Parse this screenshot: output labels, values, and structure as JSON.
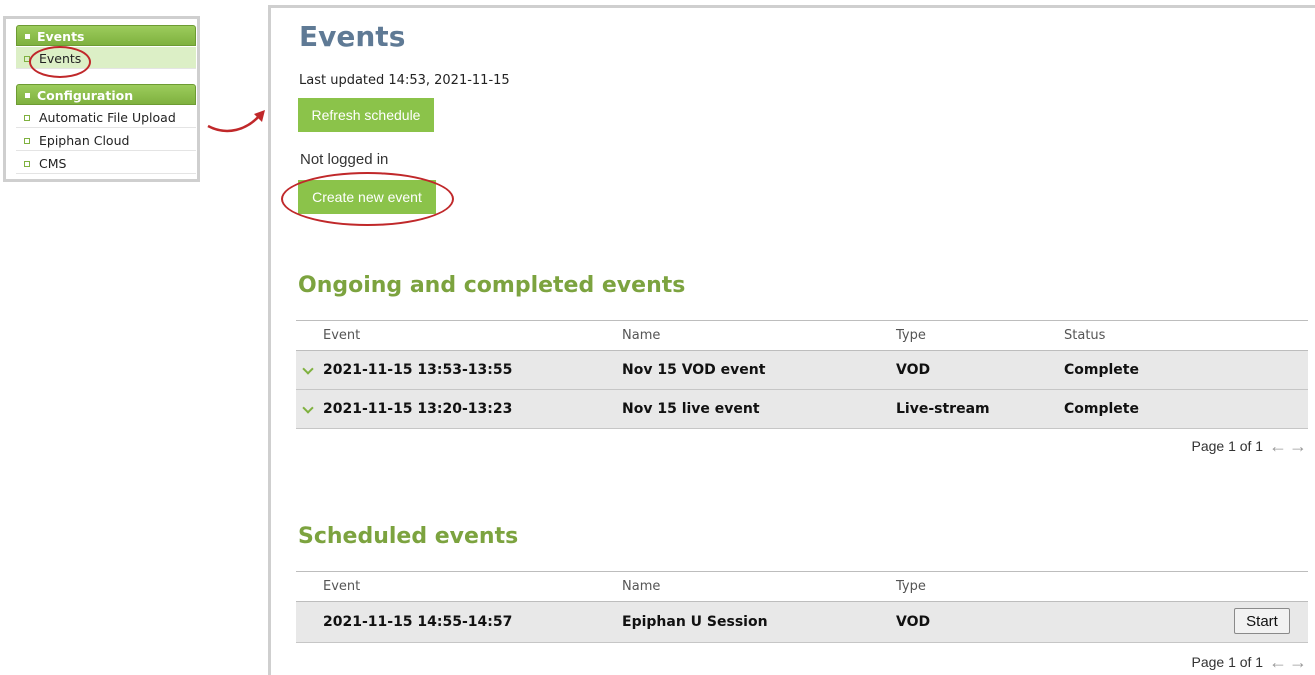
{
  "sidebar": {
    "events_header": "Events",
    "events_item": "Events",
    "config_header": "Configuration",
    "config_items": [
      "Automatic File Upload",
      "Epiphan Cloud",
      "CMS"
    ]
  },
  "main": {
    "title": "Events",
    "last_updated": "Last updated 14:53, 2021-11-15",
    "refresh_button": "Refresh schedule",
    "login_status": "Not logged in",
    "create_button": "Create new event"
  },
  "ongoing": {
    "title": "Ongoing and completed events",
    "headers": {
      "event": "Event",
      "name": "Name",
      "type": "Type",
      "status": "Status"
    },
    "rows": [
      {
        "event": "2021-11-15 13:53-13:55",
        "name": "Nov 15 VOD event",
        "type": "VOD",
        "status": "Complete"
      },
      {
        "event": "2021-11-15 13:20-13:23",
        "name": "Nov 15 live event",
        "type": "Live-stream",
        "status": "Complete"
      }
    ],
    "pager": "Page 1 of 1"
  },
  "scheduled": {
    "title": "Scheduled events",
    "headers": {
      "event": "Event",
      "name": "Name",
      "type": "Type"
    },
    "rows": [
      {
        "event": "2021-11-15 14:55-14:57",
        "name": "Epiphan U Session",
        "type": "VOD",
        "action": "Start"
      }
    ],
    "pager": "Page 1 of 1"
  },
  "icons": {
    "pager_prev": "left-arrow-icon",
    "pager_next": "right-arrow-icon",
    "expand": "chevron-down-icon"
  },
  "colors": {
    "accent_green": "#8bc34a",
    "title_blue": "#5f7a95",
    "section_green": "#7ca33f",
    "annotation_red": "#c0282a"
  }
}
